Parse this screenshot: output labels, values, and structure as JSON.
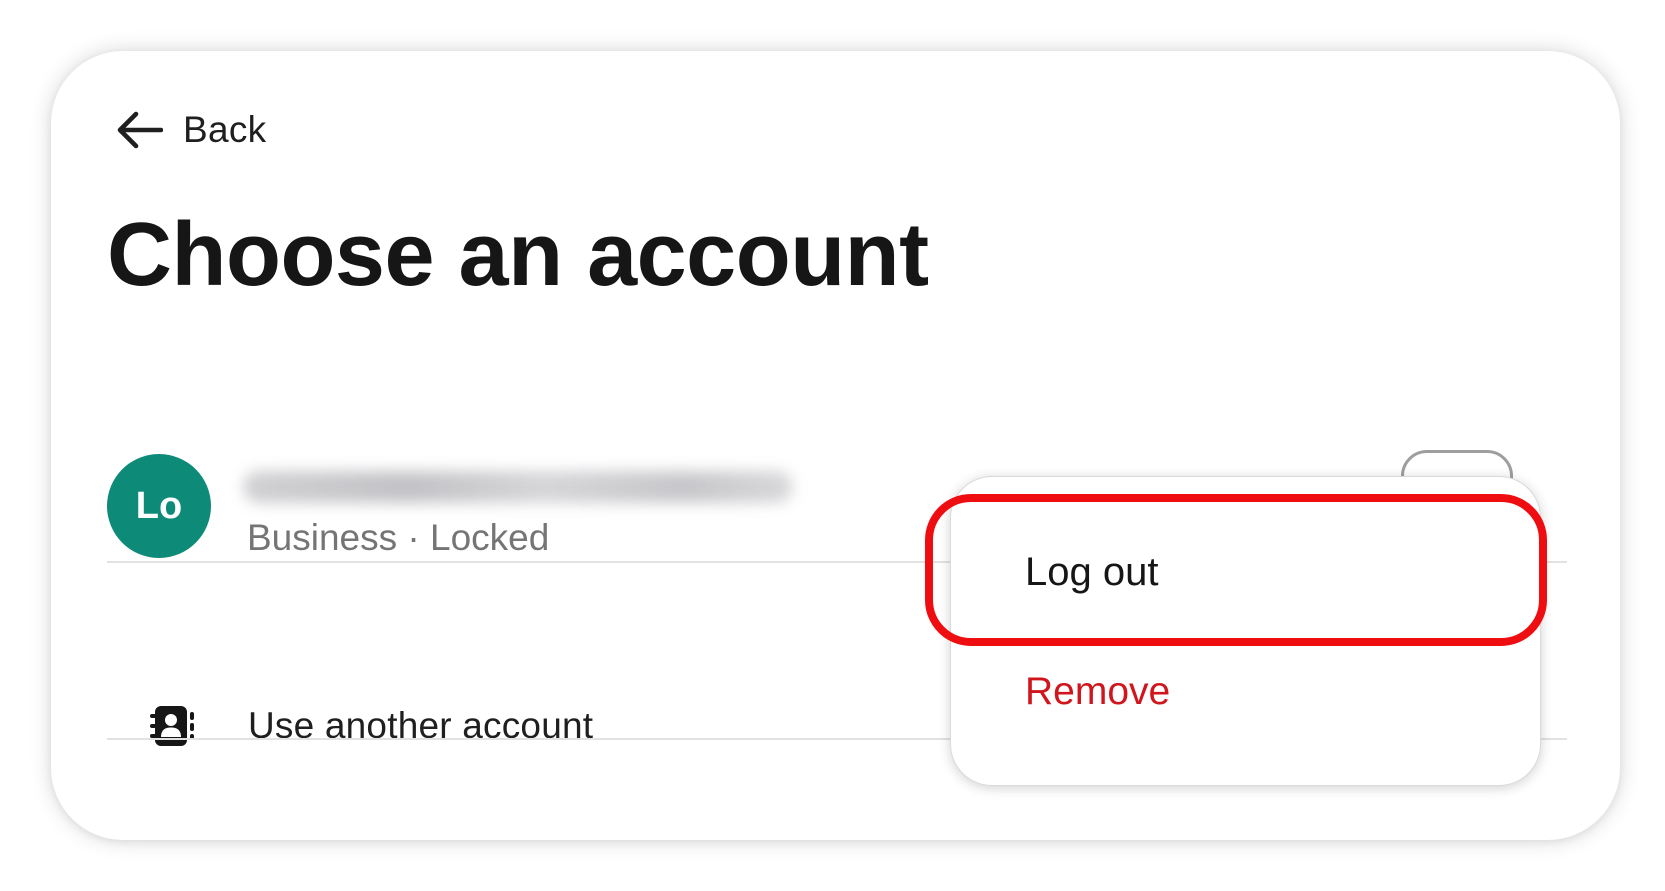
{
  "header": {
    "back_label": "Back",
    "title": "Choose an account"
  },
  "account": {
    "avatar_initials": "Lo",
    "avatar_color": "#0e8a78",
    "email": "",
    "status": "Business · Locked",
    "more_icon": "more-horizontal-icon"
  },
  "other": {
    "icon": "contact-book-icon",
    "label": "Use another account"
  },
  "menu": {
    "logout_label": "Log out",
    "remove_label": "Remove",
    "remove_color": "#d0161c"
  },
  "highlight": {
    "color": "#ee0e12",
    "target": "Log out"
  }
}
